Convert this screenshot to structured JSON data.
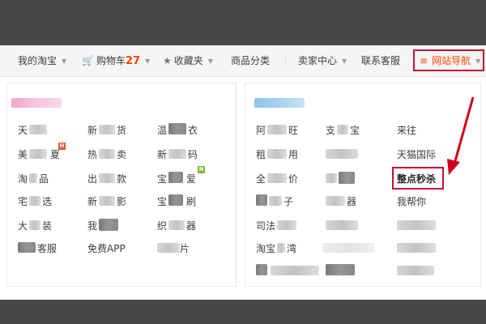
{
  "navbar": {
    "my_taobao": "我的淘宝",
    "cart_label": "购物车",
    "cart_count": "27",
    "favorites": "收藏夹",
    "categories": "商品分类",
    "seller_center": "卖家中心",
    "contact_service": "联系客服",
    "site_nav": "网站导航"
  },
  "left_panel": {
    "links": [
      {
        "text": "天",
        "blur_after": true
      },
      {
        "text": "新",
        "suffix": "货"
      },
      {
        "text": "温",
        "suffix": "衣"
      },
      {
        "text": "美",
        "suffix": "夏",
        "badge": "H"
      },
      {
        "text": "热",
        "suffix": "卖"
      },
      {
        "text": "新",
        "suffix": "码"
      },
      {
        "text": "淘",
        "suffix": "品"
      },
      {
        "text": "出",
        "suffix": "款"
      },
      {
        "text": "宝",
        "suffix": "爱",
        "badge": "N"
      },
      {
        "text": "宅",
        "suffix": "选"
      },
      {
        "text": "新",
        "suffix": "影"
      },
      {
        "text": "宝",
        "suffix": "刷"
      },
      {
        "text": "大",
        "suffix": "装"
      },
      {
        "text": "我",
        "suffix": ""
      },
      {
        "text": "织",
        "suffix": "器"
      },
      {
        "text": "",
        "suffix": "客服"
      },
      {
        "text": "免费APP",
        "suffix": ""
      },
      {
        "text": "",
        "suffix": "片"
      }
    ]
  },
  "right_panel": {
    "links": [
      {
        "text": "阿",
        "suffix": "旺"
      },
      {
        "text": "支",
        "suffix": "宝"
      },
      {
        "text": "来往"
      },
      {
        "text": "租",
        "suffix": "用"
      },
      {
        "text": "",
        "suffix": ""
      },
      {
        "text": "天猫国际"
      },
      {
        "text": "全",
        "suffix": "价"
      },
      {
        "text": "",
        "suffix": ""
      },
      {
        "text": "整点秒杀"
      },
      {
        "text": "",
        "suffix": "子"
      },
      {
        "text": "",
        "suffix": "器"
      },
      {
        "text": "我帮你"
      },
      {
        "text": "司法",
        "suffix": ""
      },
      {
        "text": "",
        "suffix": ""
      },
      {
        "text": "",
        "suffix": ""
      },
      {
        "text": "淘宝",
        "suffix": "湾"
      }
    ]
  },
  "colors": {
    "accent": "#ff4400",
    "highlight_border": "#c8102e",
    "background_frame": "#484848"
  },
  "icons": {
    "cart": "cart-icon",
    "star": "star-icon",
    "menu": "menu-icon",
    "caret": "caret-down-icon",
    "arrow": "red-arrow-annotation"
  }
}
